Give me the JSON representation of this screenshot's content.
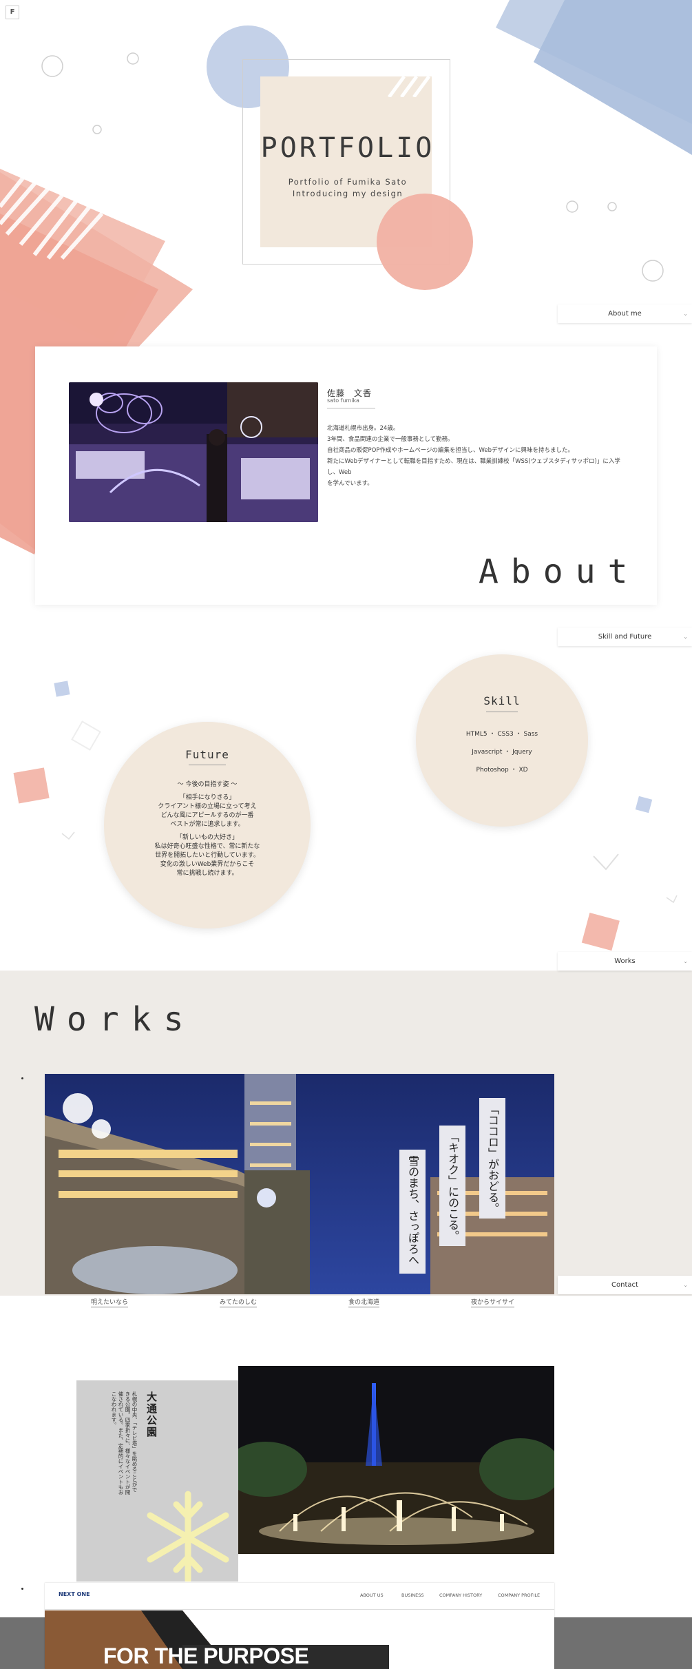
{
  "header": {
    "logo": "F",
    "menu_icon": "hamburger-icon"
  },
  "hero": {
    "title": "PORTFOLIO",
    "subtitle_1": "Portfolio of Fumika Sato",
    "subtitle_2": "Introducing my design"
  },
  "tabs": {
    "about": "About me",
    "skill": "Skill and Future",
    "works": "Works",
    "contact": "Contact"
  },
  "about": {
    "name_jp": "佐藤　文香",
    "name_en": "sato fumika",
    "lines": [
      "北海道札幌市出身。24歳。",
      "3年間、食品関連の企業で一般事務として勤務。",
      "自社商品の販促POP作成やホームページの編集を担当し、Webデザインに興味を持ちました。",
      "新たにWebデザイナーとして転職を目指すため、現在は、職業訓練校「WSS(ウェブスタディサッポロ)」に入学し、Web",
      "を学んでいます。"
    ],
    "heading": "About"
  },
  "skill": {
    "title": "Skill",
    "lines": [
      "HTML5 ・ CSS3 ・ Sass",
      "Javascript ・ Jquery",
      "Photoshop ・ XD"
    ]
  },
  "future": {
    "title": "Future",
    "lines": [
      "～ 今後の目指す姿 ～",
      "",
      "「相手になりきる」",
      "クライアント様の立場に立って考え",
      "どんな風にアピールするのが一番",
      "ベストが常に追求します。",
      "",
      "「新しいもの大好き」",
      "私は好奇心旺盛な性格で、常に新たな",
      "世界を開拓したいと行動しています。",
      "変化の激しいWeb業界だからこそ",
      "常に挑戦し続けます。"
    ]
  },
  "works": {
    "heading": "Works",
    "slide1": {
      "copy_1": "「ココロ」がおどる。",
      "copy_2": "「キオク」にのこる。",
      "copy_3": "雪のまち、さっぽろへ",
      "nav": [
        "明えたいなら",
        "みてたのしむ",
        "食の北海道",
        "夜からサイサイ"
      ]
    },
    "slide2": {
      "title": "大通公園",
      "text": "札幌の中央、「テレビ塔」を眺めることができる公園。四季折々に、様々なイベントが開催されている。また、定期的にイベントもおこなわれます。"
    },
    "slide3": {
      "logo": "NEXT ONE",
      "nav": [
        "ABOUT US",
        "BUSINESS",
        "COMPANY HISTORY",
        "COMPANY PROFILE"
      ],
      "headline": "FOR THE PURPOSE"
    }
  },
  "colors": {
    "accent_salmon": "#eea394",
    "accent_blue": "#a9bddc",
    "beige": "#f2e8dc",
    "works_bg": "#eeebe7"
  }
}
